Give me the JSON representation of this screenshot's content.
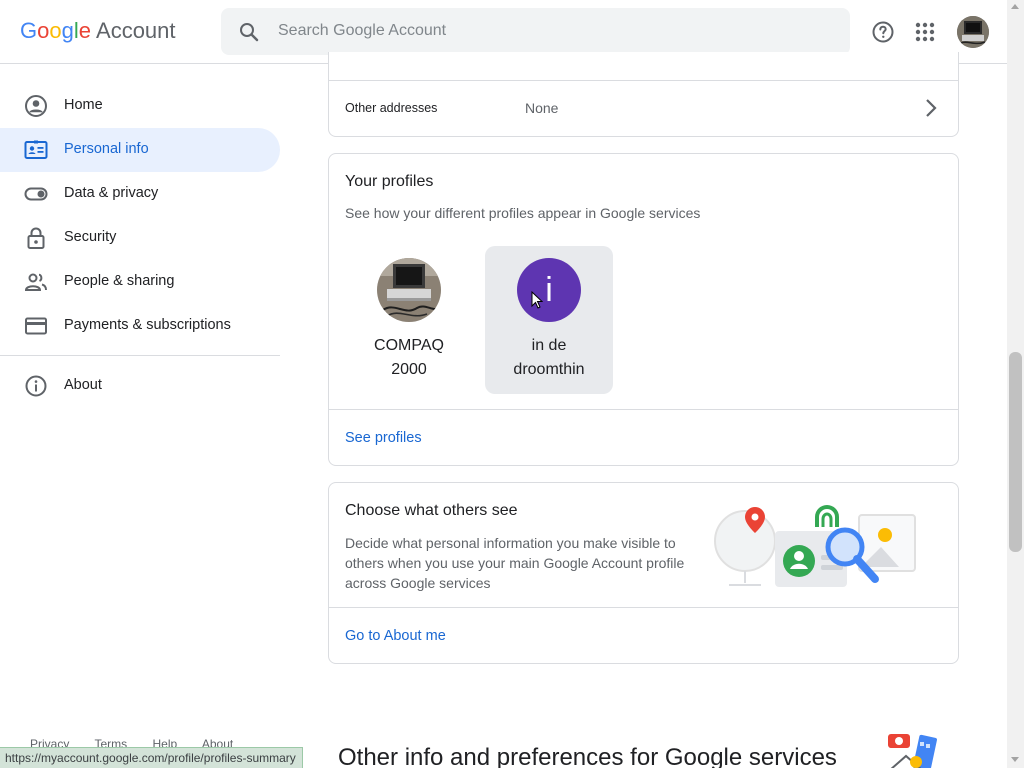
{
  "header": {
    "logo_letters": [
      "G",
      "o",
      "o",
      "g",
      "l",
      "e"
    ],
    "logo_suffix": "Account",
    "search_placeholder": "Search Google Account",
    "icons": [
      "search-icon",
      "help-icon",
      "apps-grid-icon",
      "account-avatar"
    ]
  },
  "sidebar": {
    "items": [
      {
        "label": "Home",
        "icon": "home-person-icon"
      },
      {
        "label": "Personal info",
        "icon": "id-card-icon",
        "active": true
      },
      {
        "label": "Data & privacy",
        "icon": "toggle-icon"
      },
      {
        "label": "Security",
        "icon": "lock-icon"
      },
      {
        "label": "People & sharing",
        "icon": "people-icon"
      },
      {
        "label": "Payments & subscriptions",
        "icon": "credit-card-icon"
      },
      {
        "label": "About",
        "icon": "info-icon"
      }
    ]
  },
  "addresses": {
    "label": "Other addresses",
    "value": "None"
  },
  "profiles": {
    "title": "Your profiles",
    "subtitle": "See how your different profiles appear in Google services",
    "items": [
      {
        "name_line1": "COMPAQ",
        "name_line2": "2000",
        "type": "photo"
      },
      {
        "name_line1": "in de",
        "name_line2": "droomthin",
        "initial": "i",
        "type": "initial"
      }
    ],
    "link": "See profiles"
  },
  "choose": {
    "title": "Choose what others see",
    "description": "Decide what personal information you make visible to others when you use your main Google Account profile across Google services",
    "link": "Go to About me"
  },
  "footer": {
    "links": [
      "Privacy",
      "Terms",
      "Help",
      "About"
    ],
    "section_title": "Other info and preferences for Google services"
  },
  "status_bar": {
    "url": "https://myaccount.google.com/profile/profiles-summary"
  },
  "colors": {
    "accent": "#1967d2",
    "active_bg": "#e8f0fe",
    "initial_avatar": "#5e35b1"
  }
}
